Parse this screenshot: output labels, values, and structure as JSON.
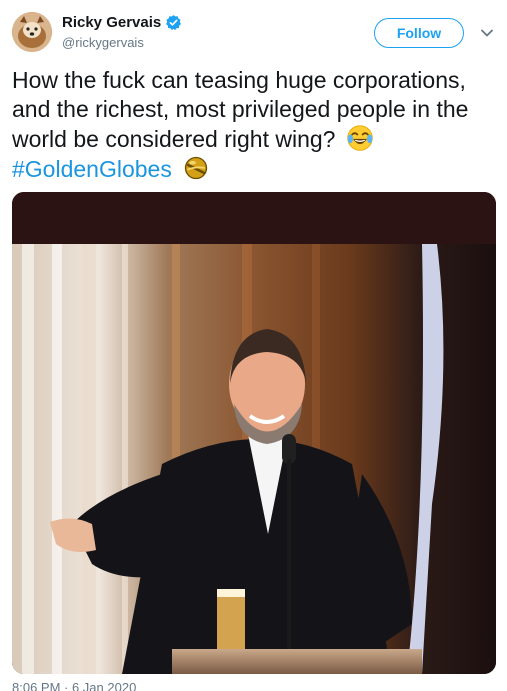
{
  "tweet": {
    "author": {
      "display_name": "Ricky Gervais",
      "handle": "@rickygervais",
      "verified": true
    },
    "follow_label": "Follow",
    "text": "How the fuck can teasing huge corporations, and the richest, most  privileged people in the world be considered right wing?",
    "hashtag": "#GoldenGlobes",
    "emoji": "face-with-tears-of-joy",
    "hashtag_emoji": "golden-globe-hashflag",
    "timestamp_partial": "8:06 PM · 6 Jan 2020"
  },
  "colors": {
    "accent": "#1da1f2",
    "hashtag": "#1b95e0",
    "text": "#14171a",
    "muted": "#657786"
  }
}
